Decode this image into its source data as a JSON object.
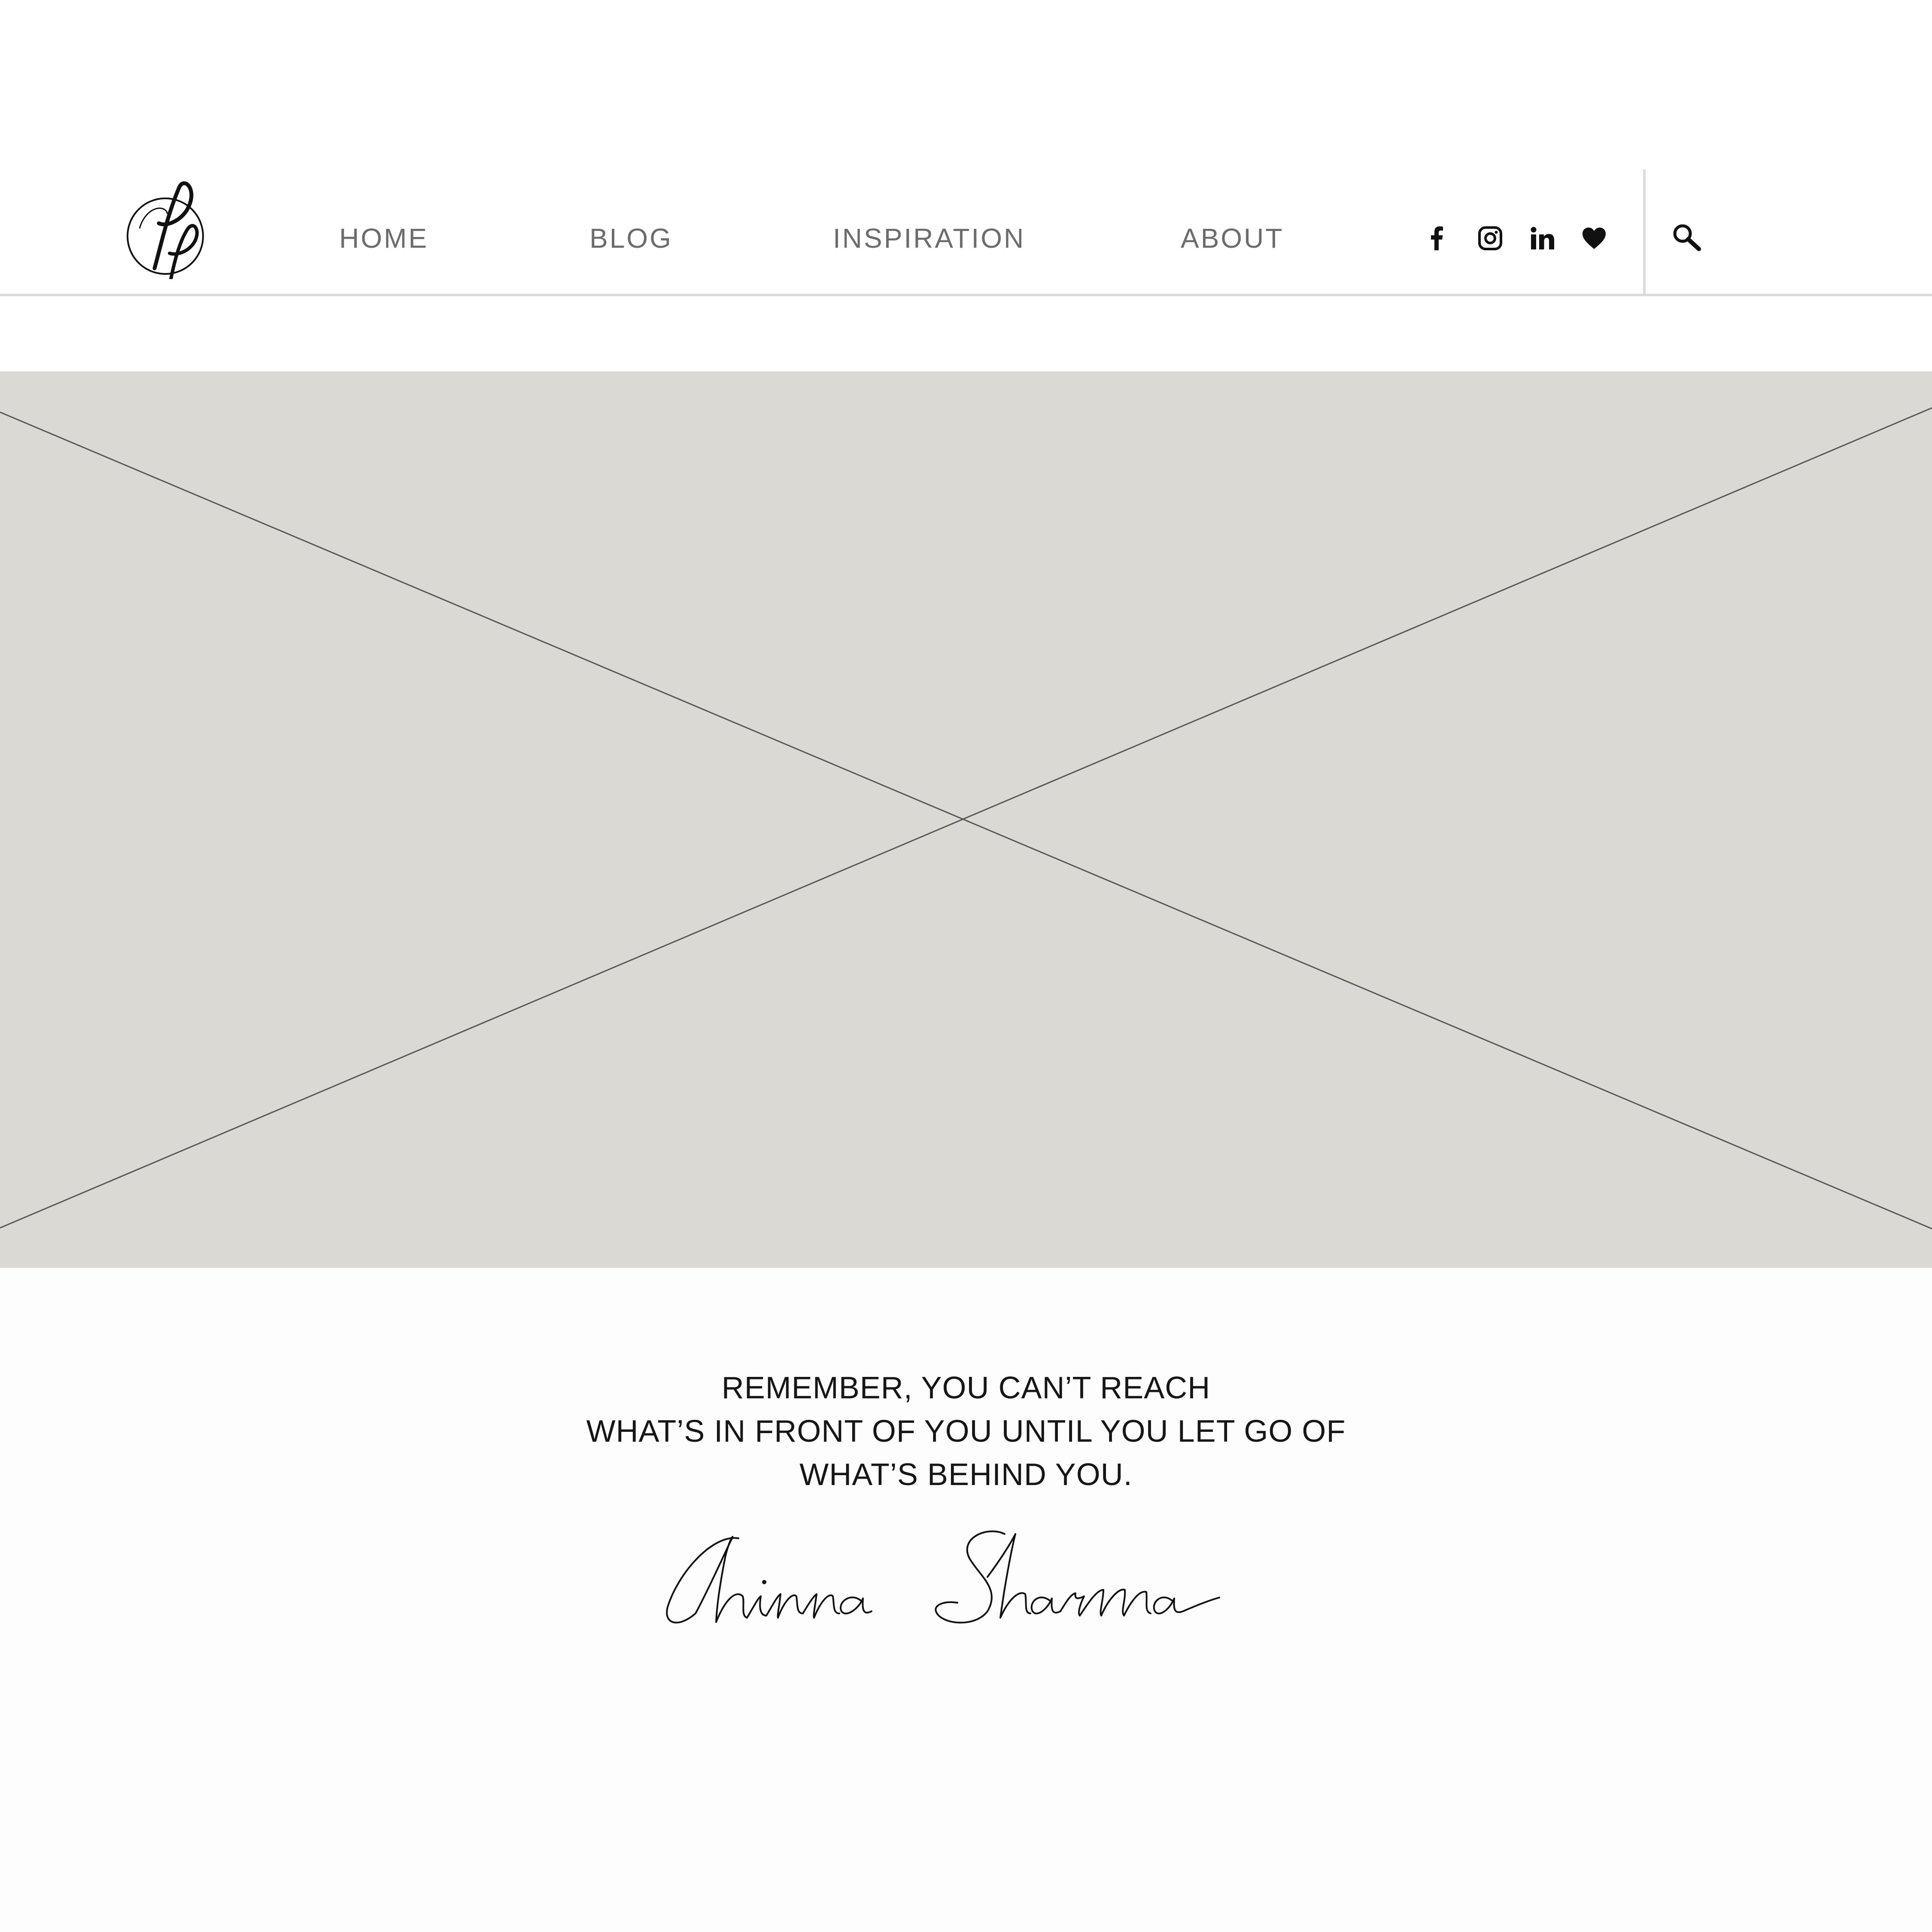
{
  "header": {
    "logo_icon": "pp-monogram-logo",
    "nav": [
      {
        "label": "HOME"
      },
      {
        "label": "BLOG"
      },
      {
        "label": "INSPIRATION"
      },
      {
        "label": "ABOUT"
      }
    ],
    "social_icons": [
      "facebook-icon",
      "instagram-icon",
      "linkedin-icon",
      "heart-icon"
    ],
    "search_icon": "search-icon"
  },
  "hero": {
    "type": "image-placeholder",
    "color": "#dad9d4"
  },
  "quote": {
    "lines": [
      "REMEMBER, YOU CAN’T REACH",
      "WHAT’S IN FRONT OF YOU UNTIL YOU LET GO OF",
      "WHAT’S BEHIND YOU."
    ],
    "signature": "Chinna Sharma"
  },
  "colors": {
    "nav_text": "#6c6c6c",
    "divider": "#dcdcdc",
    "quote_text": "#161616"
  }
}
